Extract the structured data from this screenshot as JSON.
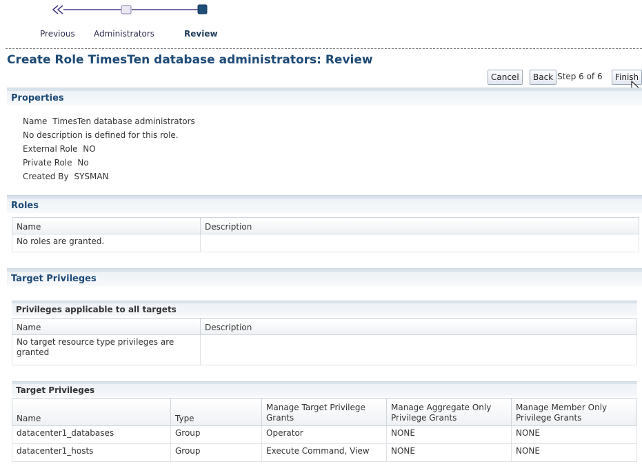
{
  "train": {
    "previous_label": "Previous",
    "step_administrators_label": "Administrators",
    "step_review_label": "Review",
    "colors": {
      "line": "#4a3a8a",
      "visited": "#ebe7f3",
      "current": "#1f4e79"
    }
  },
  "header": {
    "title": "Create Role TimesTen database administrators: Review"
  },
  "buttons": {
    "cancel": "Cancel",
    "back": "Back",
    "step_text": "Step 6 of 6",
    "finish": "Finish"
  },
  "properties": {
    "section_title": "Properties",
    "name_label": "Name",
    "name_value": "TimesTen database administrators",
    "description_text": "No description is defined for this role.",
    "external_role_label": "External Role",
    "external_role_value": "NO",
    "private_role_label": "Private Role",
    "private_role_value": "No",
    "created_by_label": "Created By",
    "created_by_value": "SYSMAN"
  },
  "roles": {
    "section_title": "Roles",
    "columns": [
      "Name",
      "Description"
    ],
    "empty_text": "No roles are granted."
  },
  "target_privileges": {
    "section_title": "Target Privileges",
    "all_targets": {
      "title": "Privileges applicable to all targets",
      "columns": [
        "Name",
        "Description"
      ],
      "empty_text": "No target resource type privileges are granted"
    },
    "privileges_table": {
      "title": "Target Privileges",
      "columns": [
        "Name",
        "Type",
        "Manage Target Privilege Grants",
        "Manage Aggregate Only Privilege Grants",
        "Manage Member Only Privilege Grants"
      ],
      "rows": [
        [
          "datacenter1_databases",
          "Group",
          "Operator",
          "NONE",
          "NONE"
        ],
        [
          "datacenter1_hosts",
          "Group",
          "Execute Command, View",
          "NONE",
          "NONE"
        ]
      ]
    }
  }
}
